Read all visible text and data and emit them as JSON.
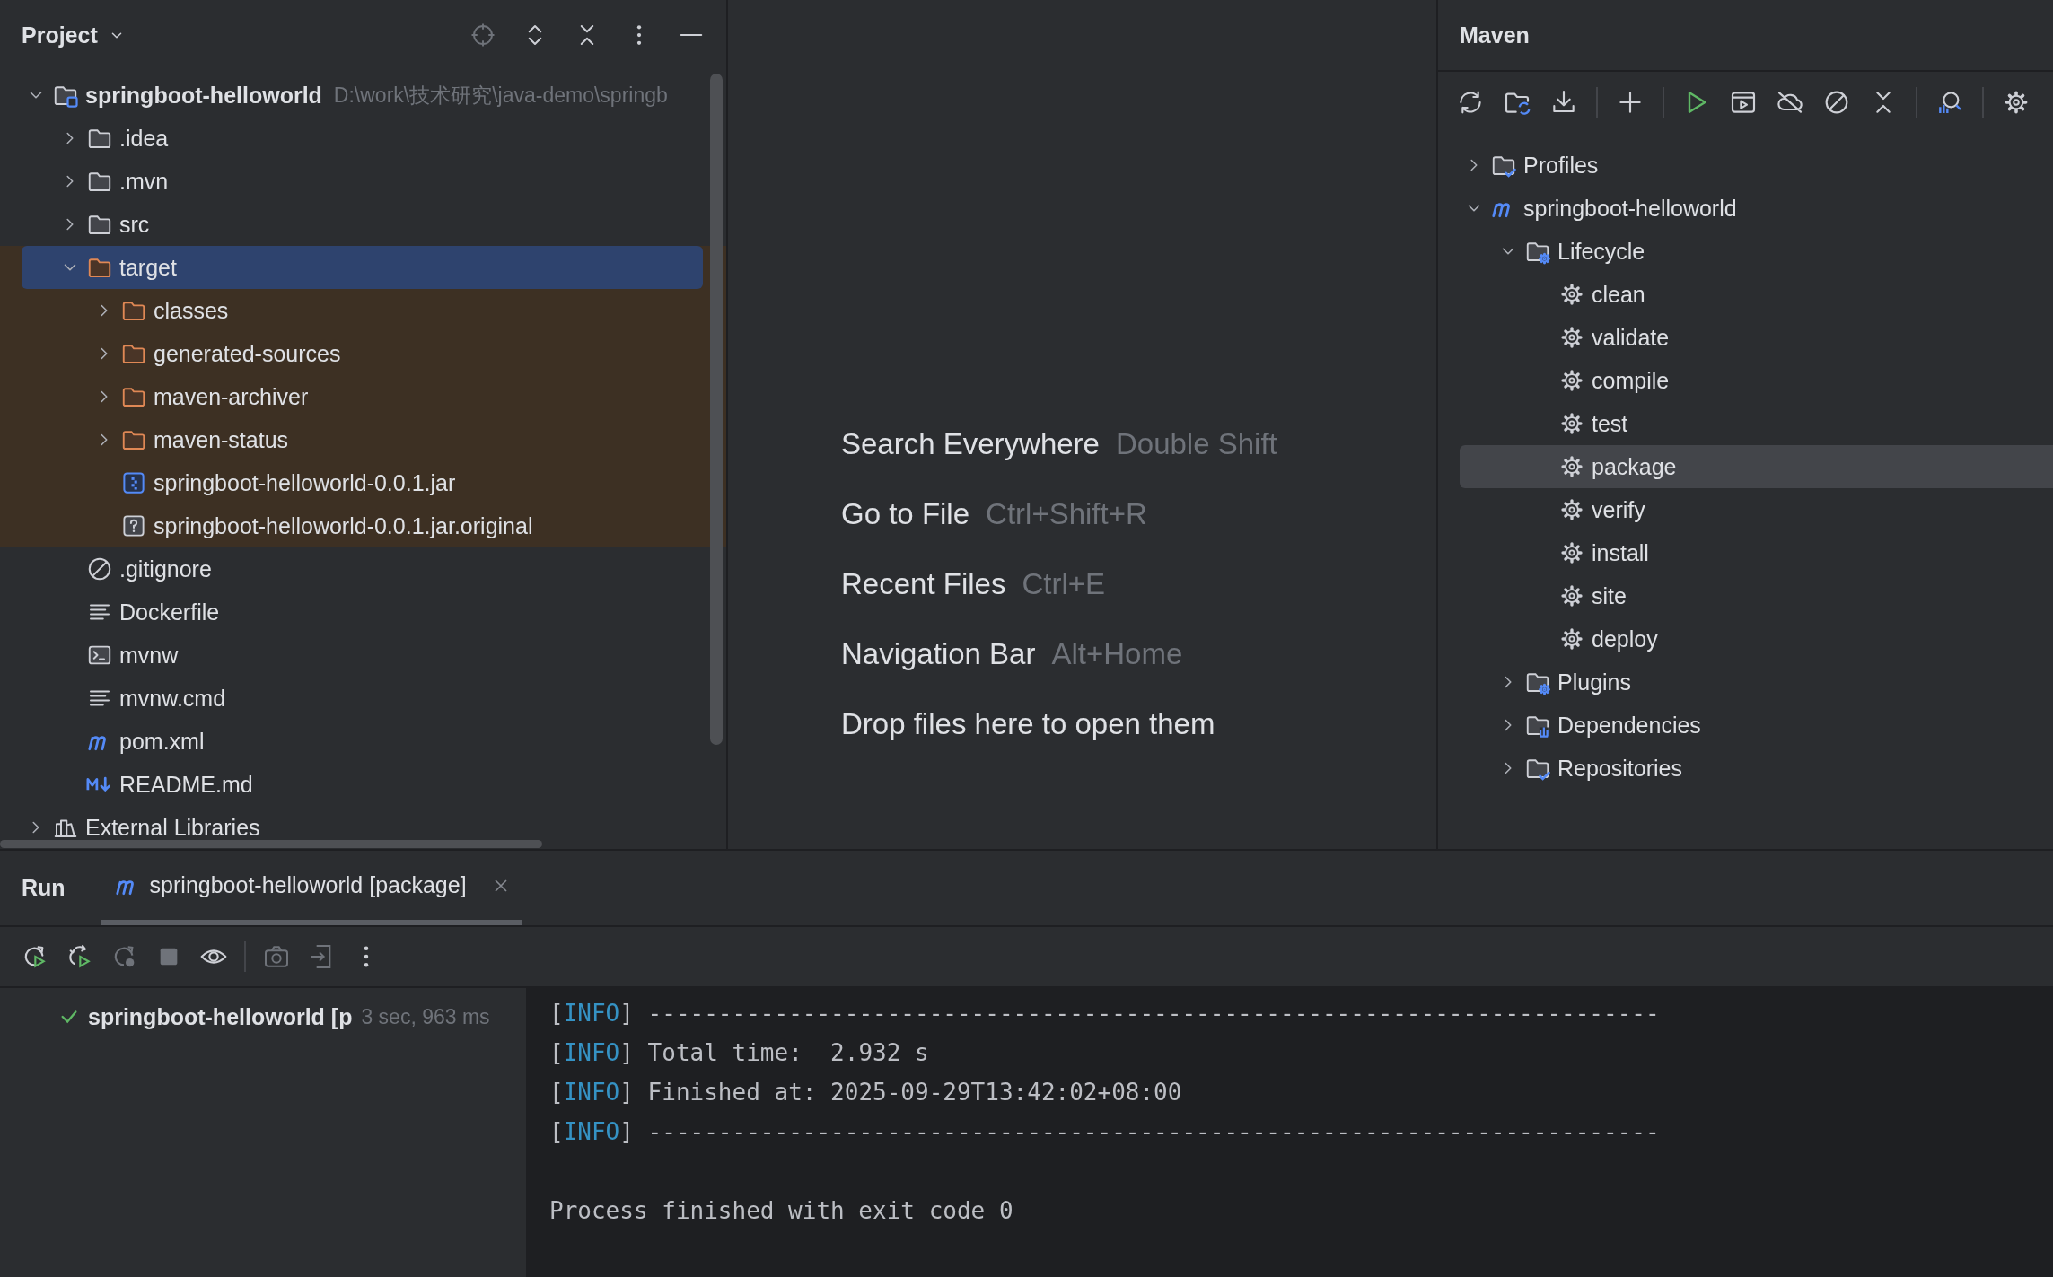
{
  "project_panel": {
    "title": "Project",
    "tree": [
      {
        "label": "springboot-helloworld",
        "kind": "module",
        "path": "D:\\work\\技术研究\\java-demo\\springb",
        "expanded": true,
        "selected": false,
        "excluded": false,
        "children": [
          {
            "label": ".idea",
            "kind": "folder",
            "expanded": false,
            "selected": false,
            "excluded": false
          },
          {
            "label": ".mvn",
            "kind": "folder",
            "expanded": false,
            "selected": false,
            "excluded": false
          },
          {
            "label": "src",
            "kind": "folder",
            "expanded": false,
            "selected": false,
            "excluded": false
          },
          {
            "label": "target",
            "kind": "folder",
            "expanded": true,
            "selected": true,
            "excluded": true,
            "children": [
              {
                "label": "classes",
                "kind": "folder",
                "expanded": false,
                "selected": false,
                "excluded": true
              },
              {
                "label": "generated-sources",
                "kind": "folder",
                "expanded": false,
                "selected": false,
                "excluded": true
              },
              {
                "label": "maven-archiver",
                "kind": "folder",
                "expanded": false,
                "selected": false,
                "excluded": true
              },
              {
                "label": "maven-status",
                "kind": "folder",
                "expanded": false,
                "selected": false,
                "excluded": true
              },
              {
                "label": "springboot-helloworld-0.0.1.jar",
                "kind": "jar",
                "selected": false,
                "excluded": true
              },
              {
                "label": "springboot-helloworld-0.0.1.jar.original",
                "kind": "unknown",
                "selected": false,
                "excluded": true
              }
            ]
          },
          {
            "label": ".gitignore",
            "kind": "ignore",
            "selected": false,
            "excluded": false
          },
          {
            "label": "Dockerfile",
            "kind": "text",
            "selected": false,
            "excluded": false
          },
          {
            "label": "mvnw",
            "kind": "script",
            "selected": false,
            "excluded": false
          },
          {
            "label": "mvnw.cmd",
            "kind": "text",
            "selected": false,
            "excluded": false
          },
          {
            "label": "pom.xml",
            "kind": "maven",
            "selected": false,
            "excluded": false
          },
          {
            "label": "README.md",
            "kind": "markdown",
            "selected": false,
            "excluded": false
          }
        ]
      },
      {
        "label": "External Libraries",
        "kind": "libraries",
        "expanded": false,
        "selected": false,
        "excluded": false
      }
    ]
  },
  "editor": {
    "hints": [
      {
        "label": "Search Everywhere",
        "shortcut": "Double Shift"
      },
      {
        "label": "Go to File",
        "shortcut": "Ctrl+Shift+R"
      },
      {
        "label": "Recent Files",
        "shortcut": "Ctrl+E"
      },
      {
        "label": "Navigation Bar",
        "shortcut": "Alt+Home"
      },
      {
        "label": "Drop files here to open them"
      }
    ]
  },
  "maven_panel": {
    "title": "Maven",
    "tree": [
      {
        "label": "Profiles",
        "kind": "profiles",
        "expanded": false,
        "selected": false
      },
      {
        "label": "springboot-helloworld",
        "kind": "maven",
        "expanded": true,
        "selected": false,
        "children": [
          {
            "label": "Lifecycle",
            "kind": "lifecycle",
            "expanded": true,
            "selected": false,
            "children": [
              {
                "label": "clean",
                "kind": "goal",
                "selected": false
              },
              {
                "label": "validate",
                "kind": "goal",
                "selected": false
              },
              {
                "label": "compile",
                "kind": "goal",
                "selected": false
              },
              {
                "label": "test",
                "kind": "goal",
                "selected": false
              },
              {
                "label": "package",
                "kind": "goal",
                "selected": true
              },
              {
                "label": "verify",
                "kind": "goal",
                "selected": false
              },
              {
                "label": "install",
                "kind": "goal",
                "selected": false
              },
              {
                "label": "site",
                "kind": "goal",
                "selected": false
              },
              {
                "label": "deploy",
                "kind": "goal",
                "selected": false
              }
            ]
          },
          {
            "label": "Plugins",
            "kind": "plugins",
            "expanded": false,
            "selected": false
          },
          {
            "label": "Dependencies",
            "kind": "dependencies",
            "expanded": false,
            "selected": false
          },
          {
            "label": "Repositories",
            "kind": "repositories",
            "expanded": false,
            "selected": false
          }
        ]
      }
    ]
  },
  "run_panel": {
    "title": "Run",
    "tabs": [
      {
        "label": "springboot-helloworld [package]",
        "selected": true
      }
    ],
    "runs": [
      {
        "label": "springboot-helloworld [p",
        "duration": "3 sec, 963 ms",
        "passed": true
      }
    ],
    "console": [
      {
        "kind": "info",
        "open": "[",
        "tag": "INFO",
        "close": "]",
        "text": "------------------------------------------------------------------------"
      },
      {
        "kind": "info",
        "open": "[",
        "tag": "INFO",
        "close": "]",
        "text": "Total time:  2.932 s"
      },
      {
        "kind": "info",
        "open": "[",
        "tag": "INFO",
        "close": "]",
        "text": "Finished at: 2025-09-29T13:42:02+08:00"
      },
      {
        "kind": "info",
        "open": "[",
        "tag": "INFO",
        "close": "]",
        "text": "------------------------------------------------------------------------"
      },
      {
        "kind": "plain",
        "text": "Process finished with exit code 0"
      }
    ]
  }
}
